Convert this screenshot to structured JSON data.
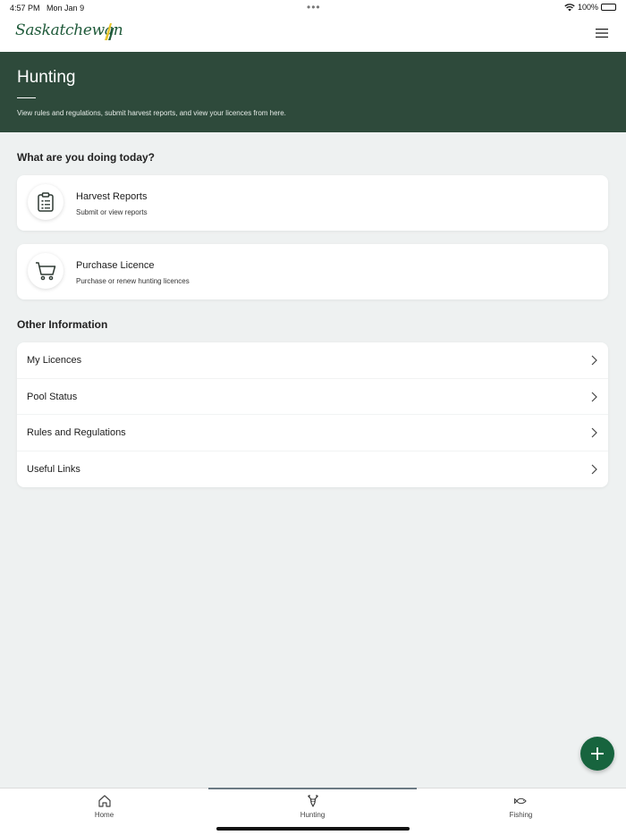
{
  "status": {
    "time": "4:57 PM",
    "date": "Mon Jan 9",
    "battery": "100%"
  },
  "brand": {
    "logo_text": "Saskatchewan",
    "primary_color": "#2e4a3b",
    "accent_color": "#17643e"
  },
  "hero": {
    "title": "Hunting",
    "description": "View rules and regulations, submit harvest reports, and view your licences from here."
  },
  "actions": {
    "section_title": "What are you doing today?",
    "items": [
      {
        "title": "Harvest Reports",
        "subtitle": "Submit or view reports",
        "icon": "clipboard-list-icon"
      },
      {
        "title": "Purchase Licence",
        "subtitle": "Purchase or renew hunting licences",
        "icon": "shopping-cart-icon"
      }
    ]
  },
  "other": {
    "section_title": "Other Information",
    "items": [
      {
        "label": "My Licences"
      },
      {
        "label": "Pool Status"
      },
      {
        "label": "Rules and Regulations"
      },
      {
        "label": "Useful Links"
      }
    ]
  },
  "tabs": [
    {
      "label": "Home",
      "icon": "home-icon",
      "active": false
    },
    {
      "label": "Hunting",
      "icon": "deer-icon",
      "active": true
    },
    {
      "label": "Fishing",
      "icon": "fish-icon",
      "active": false
    }
  ]
}
